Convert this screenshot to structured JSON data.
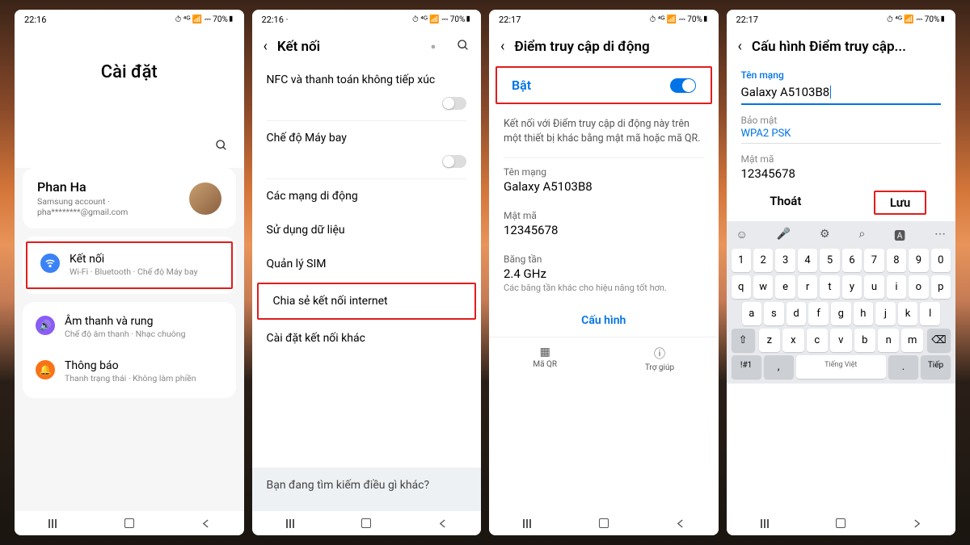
{
  "status": {
    "time1": "22:16",
    "time2": "22:16 ·",
    "time3": "22:17",
    "time4": "22:17",
    "indicators": "⏱ ⁴ᴳ 📶 ⎓ 70%▮"
  },
  "s1": {
    "title": "Cài đặt",
    "profile_name": "Phan Ha",
    "profile_sub": "Samsung account  ·\npha********@gmail.com",
    "item_conn_title": "Kết nối",
    "item_conn_sub": "Wi-Fi  ·  Bluetooth  ·  Chế độ Máy bay",
    "item_sound_title": "Âm thanh và rung",
    "item_sound_sub": "Chế độ âm thanh  ·  Nhạc chuông",
    "item_notif_title": "Thông báo",
    "item_notif_sub": "Thanh trạng thái  ·  Không làm phiền"
  },
  "s2": {
    "title": "Kết nối",
    "nfc": "NFC và thanh toán không tiếp xúc",
    "airplane": "Chế độ Máy bay",
    "mobile_nets": "Các mạng di động",
    "data_usage": "Sử dụng dữ liệu",
    "sim": "Quản lý SIM",
    "share": "Chia sẻ kết nối internet",
    "more": "Cài đặt kết nối khác",
    "search_hint": "Bạn đang tìm kiếm điều gì khác?"
  },
  "s3": {
    "title": "Điểm truy cập di động",
    "on": "Bật",
    "desc": "Kết nối với Điểm truy cập di động này trên một thiết bị khác bằng mật mã hoặc mã QR.",
    "net_lbl": "Tên mạng",
    "net_val": "Galaxy A5103B8",
    "pw_lbl": "Mật mã",
    "pw_val": "12345678",
    "band_lbl": "Băng tần",
    "band_val": "2.4 GHz",
    "band_sub": "Các băng tần khác cho hiệu năng tốt hơn.",
    "config": "Cấu hình",
    "qr": "Mã QR",
    "help": "Trợ giúp"
  },
  "s4": {
    "title": "Cấu hình Điểm truy cập...",
    "net_lbl": "Tên mạng",
    "net_val": "Galaxy A5103B8",
    "sec_lbl": "Bảo mật",
    "sec_val": "WPA2 PSK",
    "pw_lbl": "Mật mã",
    "pw_val": "12345678",
    "cancel": "Thoát",
    "save": "Lưu",
    "kb_lang": "Tiếng Việt",
    "kb_sym": "!#1",
    "kb_next": "Tiếp",
    "nums": [
      "1",
      "2",
      "3",
      "4",
      "5",
      "6",
      "7",
      "8",
      "9",
      "0"
    ],
    "r1": [
      "q",
      "w",
      "e",
      "r",
      "t",
      "y",
      "u",
      "i",
      "o",
      "p"
    ],
    "r2": [
      "a",
      "s",
      "d",
      "f",
      "g",
      "h",
      "j",
      "k",
      "l"
    ],
    "r3": [
      "z",
      "x",
      "c",
      "v",
      "b",
      "n",
      "m"
    ]
  }
}
